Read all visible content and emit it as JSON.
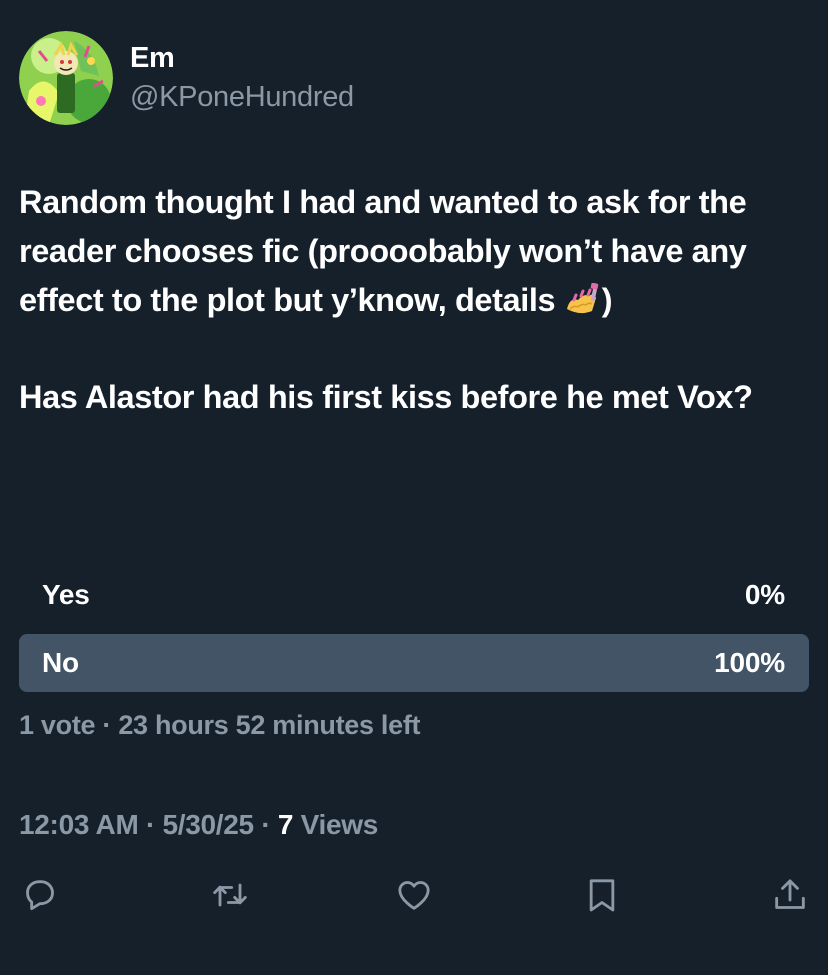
{
  "author": {
    "display_name": "Em",
    "handle": "@KPoneHundred"
  },
  "tweet": {
    "paragraph1": "Random thought I had and wanted to ask for the reader chooses fic (proooobably won’t have any effect to the plot but y’know, details",
    "paragraph1_end": ")",
    "paragraph1_emoji": "nail-polish-emoji",
    "paragraph2": "Has Alastor had his first kiss before he met Vox?"
  },
  "poll": {
    "options": [
      {
        "label": "Yes",
        "percent_text": "0%",
        "percent": 0
      },
      {
        "label": "No",
        "percent_text": "100%",
        "percent": 100
      }
    ],
    "meta": "1 vote · 23 hours 52 minutes left"
  },
  "metadata": {
    "time": "12:03 AM",
    "date": "5/30/25",
    "views_count": "7",
    "views_label": "Views"
  },
  "actions": [
    "reply-icon",
    "retweet-icon",
    "like-icon",
    "bookmark-icon",
    "share-icon"
  ],
  "colors": {
    "background": "#15202b",
    "text_primary": "#ffffff",
    "text_secondary": "#8b98a5",
    "poll_fill": "#425466"
  }
}
